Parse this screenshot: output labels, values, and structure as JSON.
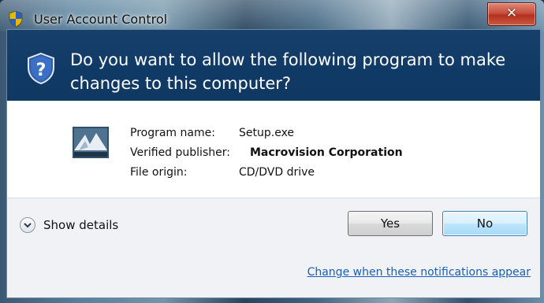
{
  "window": {
    "title": "User Account Control",
    "title_icon": "uac-shield-icon",
    "close_icon": "close-icon",
    "close_glyph": "✕"
  },
  "header": {
    "icon": "uac-shield-icon",
    "question": "Do you want to allow the following program to make changes to this computer?",
    "background_color": "#113b67"
  },
  "program": {
    "icon": "setup-program-icon",
    "fields": [
      {
        "label": "Program name:",
        "value": "Setup.exe"
      },
      {
        "label": "Verified publisher:",
        "value": "Macrovision Corporation"
      },
      {
        "label": "File origin:",
        "value": "CD/DVD drive"
      }
    ]
  },
  "footer": {
    "show_details_label": "Show details",
    "show_details_icon": "chevron-down-icon",
    "yes_label": "Yes",
    "no_label": "No",
    "change_link": "Change when these notifications appear",
    "link_color": "#1a5fb4"
  }
}
